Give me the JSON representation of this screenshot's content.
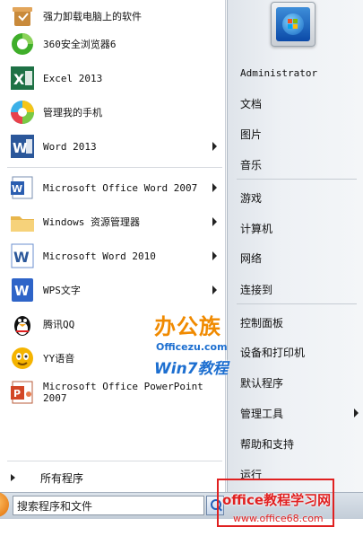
{
  "programs": [
    {
      "label": "强力卸载电脑上的软件",
      "icon": "uninstaller-icon",
      "arrow": false
    },
    {
      "label": "360安全浏览器6",
      "icon": "360-browser-icon",
      "arrow": false
    },
    {
      "label": "Excel 2013",
      "icon": "excel-icon",
      "arrow": false
    },
    {
      "label": "管理我的手机",
      "icon": "phone-manager-icon",
      "arrow": false
    },
    {
      "label": "Word 2013",
      "icon": "word-icon",
      "arrow": true
    },
    {
      "label": "Microsoft Office Word 2007",
      "icon": "word-2007-icon",
      "arrow": true
    },
    {
      "label": "Windows 资源管理器",
      "icon": "explorer-folder-icon",
      "arrow": true
    },
    {
      "label": "Microsoft Word 2010",
      "icon": "word-2010-icon",
      "arrow": true
    },
    {
      "label": "WPS文字",
      "icon": "wps-icon",
      "arrow": true
    },
    {
      "label": "腾讯QQ",
      "icon": "qq-penguin-icon",
      "arrow": false
    },
    {
      "label": "YY语音",
      "icon": "yy-voice-icon",
      "arrow": false
    },
    {
      "label": "Microsoft Office PowerPoint\n2007",
      "icon": "powerpoint-icon",
      "arrow": false
    }
  ],
  "all_programs": "所有程序",
  "right_links": [
    {
      "label": "Administrator",
      "arrow": false
    },
    {
      "label": "文档",
      "arrow": false
    },
    {
      "label": "图片",
      "arrow": false
    },
    {
      "label": "音乐",
      "arrow": false
    },
    {
      "label": "游戏",
      "arrow": false
    },
    {
      "label": "计算机",
      "arrow": false
    },
    {
      "label": "网络",
      "arrow": false
    },
    {
      "label": "连接到",
      "arrow": false
    },
    {
      "label": "控制面板",
      "arrow": false
    },
    {
      "label": "设备和打印机",
      "arrow": false
    },
    {
      "label": "默认程序",
      "arrow": false
    },
    {
      "label": "管理工具",
      "arrow": true
    },
    {
      "label": "帮助和支持",
      "arrow": false
    },
    {
      "label": "运行",
      "arrow": false
    }
  ],
  "search": {
    "placeholder": "搜索程序和文件"
  },
  "watermarks": {
    "officezu_title": "办公族",
    "officezu_url": "Officezu.com",
    "officezu_sub": "Win7教程",
    "office68_title": "office教程学习网",
    "office68_url": "www.office68.com"
  },
  "colors": {
    "accent_orange": "#f08a00",
    "accent_blue": "#1d6fd0",
    "watermark_red": "#e02020"
  }
}
